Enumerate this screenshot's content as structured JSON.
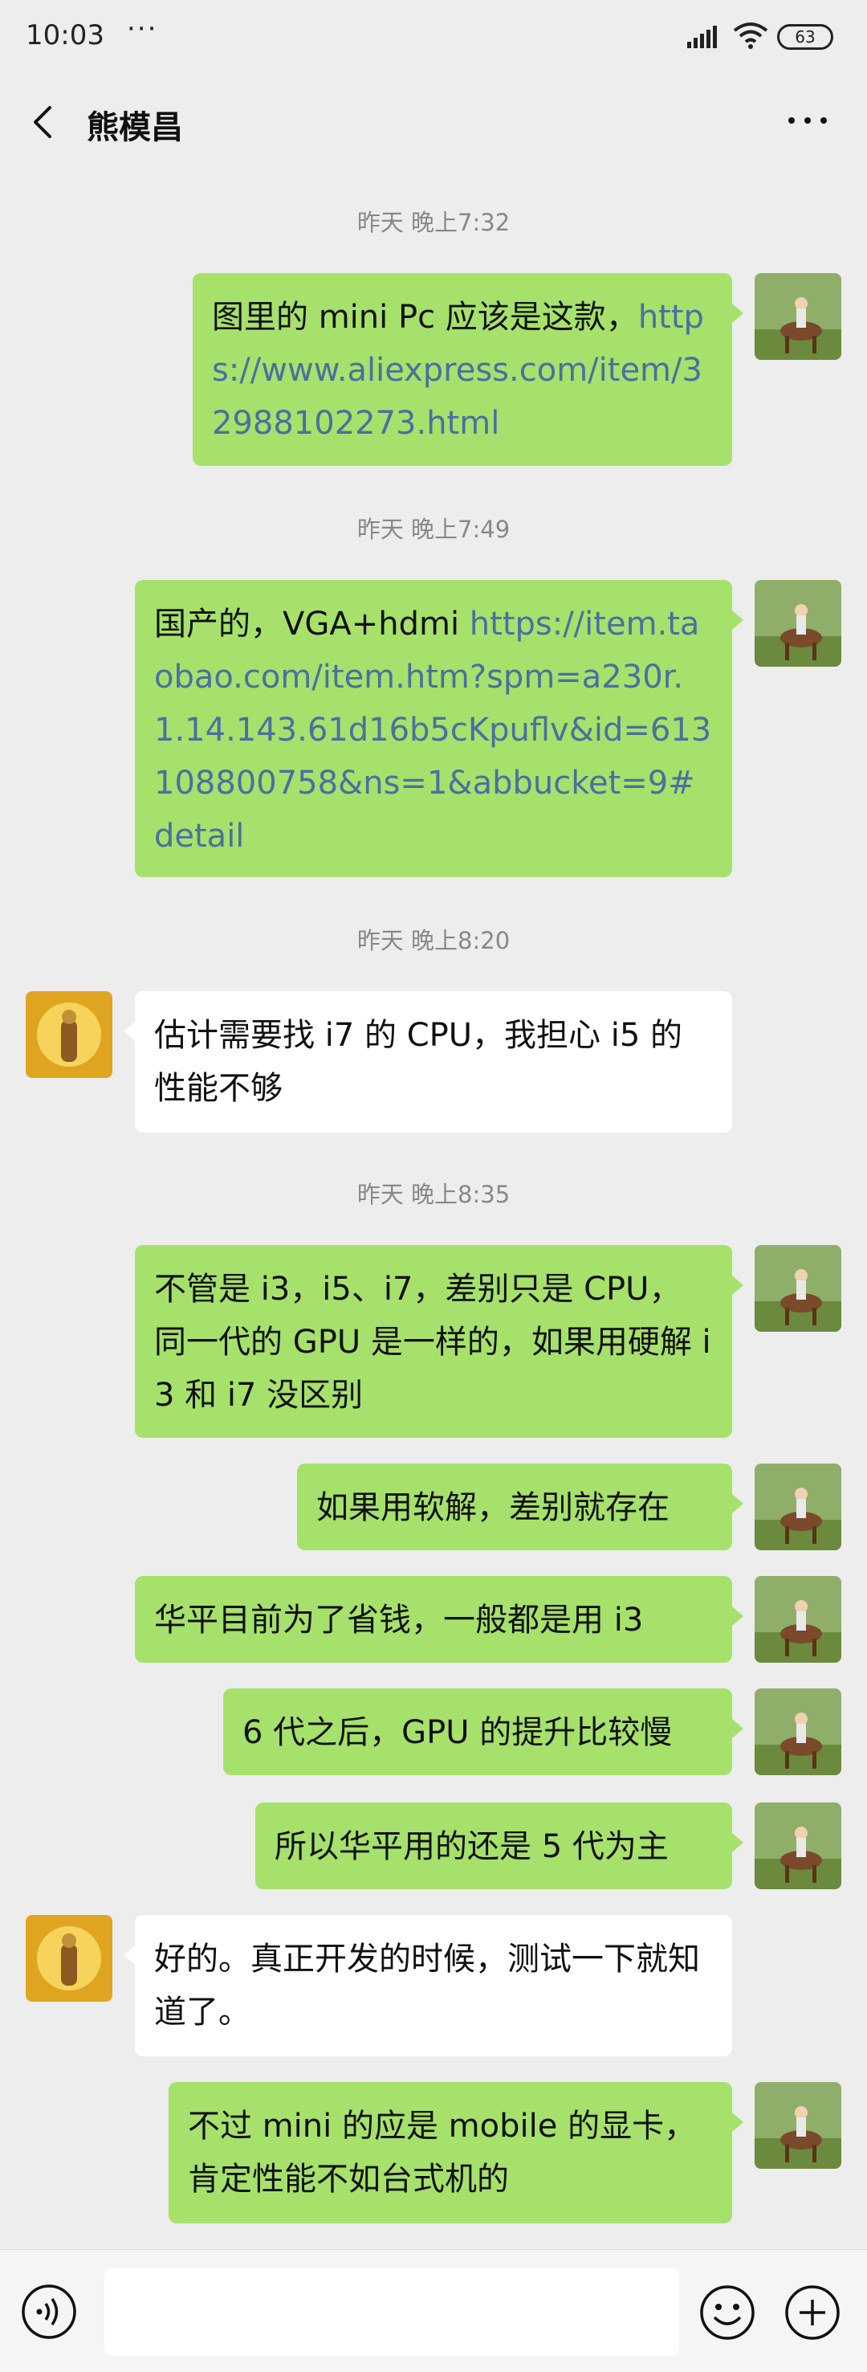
{
  "status_bar": {
    "time": "10:03",
    "dots": "···",
    "battery": "63"
  },
  "header": {
    "title": "熊模昌"
  },
  "messages": [
    {
      "type": "timestamp",
      "text": "昨天 晚上7:32"
    },
    {
      "type": "message",
      "sender": "me",
      "text": "图里的 mini Pc 应该是这款，",
      "link": "https://www.aliexpress.com/item/32988102273.html"
    },
    {
      "type": "timestamp",
      "text": "昨天 晚上7:49"
    },
    {
      "type": "message",
      "sender": "me",
      "text": "国产的，VGA+hdmi ",
      "link": "https://item.taobao.com/item.htm?spm=a230r.1.14.143.61d16b5cKpuflv&id=613108800758&ns=1&abbucket=9#detail"
    },
    {
      "type": "timestamp",
      "text": "昨天 晚上8:20"
    },
    {
      "type": "message",
      "sender": "other",
      "text": "估计需要找 i7 的 CPU，我担心 i5 的性能不够"
    },
    {
      "type": "timestamp",
      "text": "昨天 晚上8:35"
    },
    {
      "type": "message",
      "sender": "me",
      "text": "不管是 i3，i5、i7，差别只是 CPU，同一代的 GPU 是一样的，如果用硬解 i3 和 i7 没区别"
    },
    {
      "type": "message",
      "sender": "me",
      "text": "如果用软解，差别就存在"
    },
    {
      "type": "message",
      "sender": "me",
      "text": "华平目前为了省钱，一般都是用 i3"
    },
    {
      "type": "message",
      "sender": "me",
      "text": "6 代之后，GPU 的提升比较慢"
    },
    {
      "type": "message",
      "sender": "me",
      "text": "所以华平用的还是 5 代为主"
    },
    {
      "type": "message",
      "sender": "other",
      "text": "好的。真正开发的时候，测试一下就知道了。"
    },
    {
      "type": "message",
      "sender": "me",
      "text": "不过 mini 的应是 mobile 的显卡，肯定性能不如台式机的"
    }
  ],
  "icons": {
    "back": "chevron-left-icon",
    "more": "more-dots-icon",
    "voice": "voice-icon",
    "emoji": "emoji-icon",
    "plus": "plus-icon"
  },
  "colors": {
    "my_bubble": "#a6e16c",
    "other_bubble": "#ffffff",
    "link": "#4a6fa0",
    "background": "#ededed"
  },
  "input": {
    "value": "",
    "placeholder": ""
  }
}
